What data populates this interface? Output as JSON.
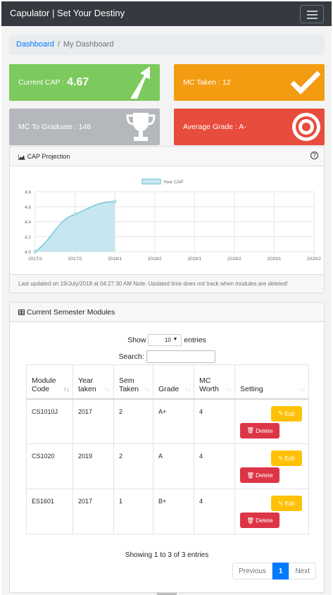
{
  "app": {
    "title": "Capulator | Set Your Destiny"
  },
  "breadcrumb": {
    "home": "Dashboard",
    "separator": "/",
    "current": "My Dashboard"
  },
  "tiles": {
    "cap": {
      "label": "Current CAP :",
      "value": "4.67",
      "color": "#7cc95d",
      "icon": "arrow-up-icon"
    },
    "mc_taken": {
      "label": "MC Taken : 12",
      "color": "#f39c12",
      "icon": "checkmark-icon"
    },
    "mc_to_grad": {
      "label": "MC To Graduate : 148",
      "color": "#b4b8bc",
      "icon": "trophy-icon"
    },
    "avg_grade": {
      "label": "Average Grade : A-",
      "color": "#e74c3c",
      "icon": "target-icon"
    }
  },
  "projection": {
    "title": "CAP Projection",
    "help": "?",
    "footer": "Last updated on 19/July/2018 at 04:27:30 AM  Note: Updated time does not track when modules are deleted!"
  },
  "chart_data": {
    "type": "area",
    "x": [
      "2017/1",
      "2017/2",
      "2018/1",
      "2018/2",
      "2019/1",
      "2019/2",
      "2020/1",
      "2020/2"
    ],
    "series": [
      {
        "name": "Your CAP",
        "values": [
          4.0,
          4.5,
          4.67
        ]
      }
    ],
    "ylim": [
      4.0,
      4.8
    ],
    "yticks": [
      "4.0",
      "4.2",
      "4.4",
      "4.6",
      "4.8"
    ],
    "grid": true,
    "legend": "top",
    "fill_color": "#c6e6f0",
    "line_color": "#6cc1d4"
  },
  "modules_card": {
    "title": "Current Semester Modules",
    "show_label": "Show",
    "entries_value": "10",
    "entries_label": "entries",
    "search_label": "Search:",
    "columns": [
      {
        "line1": "Module",
        "line2": "Code"
      },
      {
        "line1": "Year",
        "line2": "taken"
      },
      {
        "line1": "Sem",
        "line2": "Taken"
      },
      {
        "line1": "",
        "line2": "Grade"
      },
      {
        "line1": "MC",
        "line2": "Worth"
      },
      {
        "line1": "",
        "line2": "Setting"
      }
    ],
    "rows": [
      {
        "code": "CS1010J",
        "year": "2017",
        "sem": "2",
        "grade": "A+",
        "mc": "4"
      },
      {
        "code": "CS1020",
        "year": "2019",
        "sem": "2",
        "grade": "A",
        "mc": "4"
      },
      {
        "code": "ES1601",
        "year": "2017",
        "sem": "1",
        "grade": "B+",
        "mc": "4"
      }
    ],
    "edit_label": "Edit",
    "delete_label": "Delete",
    "info": "Showing 1 to 3 of 3 entries",
    "pager": {
      "previous": "Previous",
      "page": "1",
      "next": "Next"
    }
  }
}
